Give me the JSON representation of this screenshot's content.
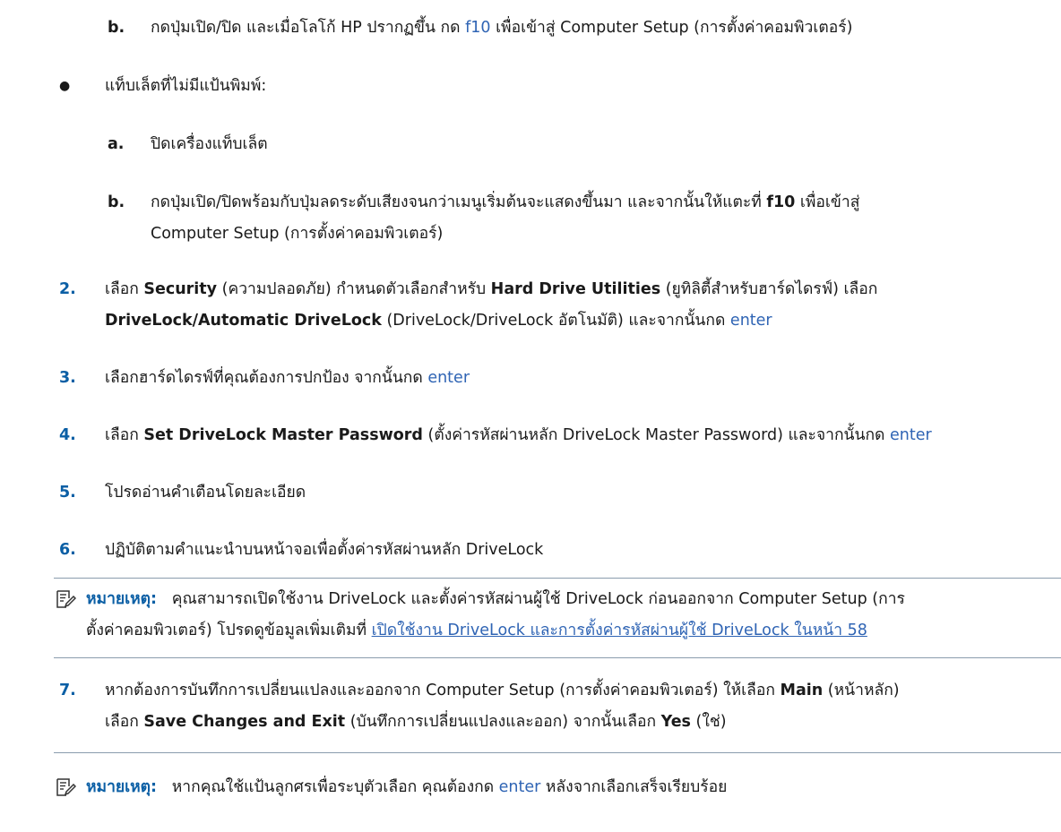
{
  "items": {
    "b1": {
      "mark": "b.",
      "t1": "กดปุ่มเปิด/ปิด และเมื่อโลโก้ HP ปรากฏขึ้น กด ",
      "key": "f10",
      "t2": " เพื่อเข้าสู่ Computer Setup (การตั้งค่าคอมพิวเตอร์)"
    },
    "bullet": {
      "mark": "●",
      "text": "แท็บเล็ตที่ไม่มีแป้นพิมพ์:"
    },
    "a": {
      "mark": "a.",
      "text": "ปิดเครื่องแท็บเล็ต"
    },
    "b2": {
      "mark": "b.",
      "t1": "กดปุ่มเปิด/ปิดพร้อมกับปุ่มลดระดับเสียงจนกว่าเมนูเริ่มต้นจะแสดงขึ้นมา และจากนั้นให้แตะที่ ",
      "key": "f10",
      "t2": " เพื่อเข้าสู่",
      "t3": "Computer Setup (การตั้งค่าคอมพิวเตอร์)"
    },
    "s2": {
      "num": "2.",
      "t1": "เลือก ",
      "b1": "Security",
      "t2": " (ความปลอดภัย) กำหนดตัวเลือกสำหรับ ",
      "b2": "Hard Drive Utilities",
      "t3": " (ยูทิลิตี้สำหรับฮาร์ดไดรฟ์) เลือก",
      "b3": "DriveLock/Automatic DriveLock",
      "t4": " (DriveLock/DriveLock อัตโนมัติ) และจากนั้นกด ",
      "key": "enter"
    },
    "s3": {
      "num": "3.",
      "t1": "เลือกฮาร์ดไดรฟ์ที่คุณต้องการปกป้อง จากนั้นกด ",
      "key": "enter"
    },
    "s4": {
      "num": "4.",
      "t1": "เลือก ",
      "b1": "Set DriveLock Master Password",
      "t2": " (ตั้งค่ารหัสผ่านหลัก DriveLock Master Password) และจากนั้นกด ",
      "key": "enter"
    },
    "s5": {
      "num": "5.",
      "text": "โปรดอ่านคำเตือนโดยละเอียด"
    },
    "s6": {
      "num": "6.",
      "text": "ปฏิบัติตามคำแนะนำบนหน้าจอเพื่อตั้งค่ารหัสผ่านหลัก DriveLock"
    },
    "note1": {
      "label": "หมายเหตุ:",
      "t1": "คุณสามารถเปิดใช้งาน DriveLock และตั้งค่ารหัสผ่านผู้ใช้ DriveLock ก่อนออกจาก Computer Setup (การ",
      "t2": "ตั้งค่าคอมพิวเตอร์) โปรดดูข้อมูลเพิ่มเติมที่ ",
      "link": "เปิดใช้งาน DriveLock และการตั้งค่ารหัสผ่านผู้ใช้ DriveLock ในหน้า 58"
    },
    "s7": {
      "num": "7.",
      "t1": "หากต้องการบันทึกการเปลี่ยนแปลงและออกจาก Computer Setup (การตั้งค่าคอมพิวเตอร์) ให้เลือก ",
      "b1": "Main",
      "t2": " (หน้าหลัก)",
      "t3": "เลือก ",
      "b2": "Save Changes and Exit",
      "t4": " (บันทึกการเปลี่ยนแปลงและออก) จากนั้นเลือก ",
      "b3": "Yes",
      "t5": " (ใช่)"
    },
    "note2": {
      "label": "หมายเหตุ:",
      "t1": "หากคุณใช้แป้นลูกศรเพื่อระบุตัวเลือก คุณต้องกด ",
      "key": "enter",
      "t2": " หลังจากเลือกเสร็จเรียบร้อย"
    }
  },
  "icon": "note-pencil-icon",
  "colors": {
    "step_number": "#0b5fa5",
    "key": "#2f64b4",
    "rule": "#8a9cad"
  }
}
